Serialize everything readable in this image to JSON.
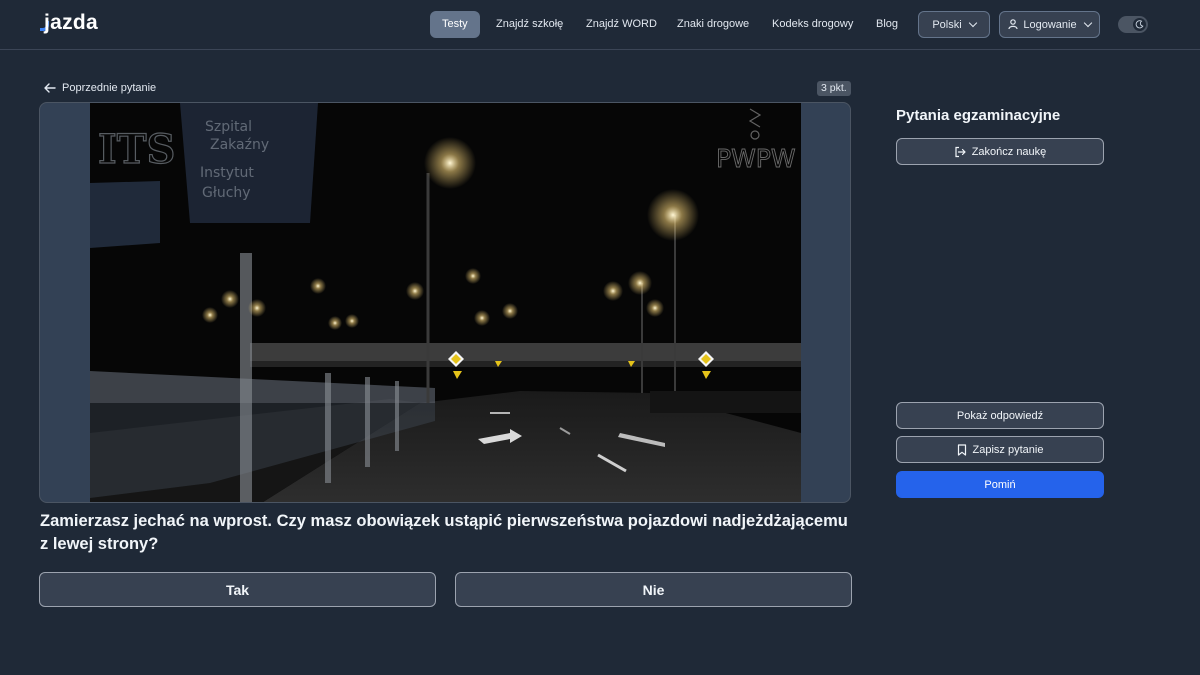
{
  "header": {
    "logo_text": "jazda",
    "nav": [
      {
        "label": "Testy",
        "active": true
      },
      {
        "label": "Znajdź szkołę"
      },
      {
        "label": "Znajdź WORD"
      },
      {
        "label": "Znaki drogowe"
      },
      {
        "label": "Kodeks drogowy"
      },
      {
        "label": "Blog"
      }
    ],
    "language_label": "Polski",
    "login_label": "Logowanie",
    "theme_toggle_icon": "moon-icon"
  },
  "question_nav": {
    "back_label": "Poprzednie pytanie",
    "points_label": "3 pkt."
  },
  "media": {
    "watermark_left": "ITS",
    "watermark_right": "PWPW",
    "sign_text_1": "Szpital",
    "sign_text_2": "Zakaźny",
    "sign_text_3": "Instytut",
    "sign_text_4": "Głuchy"
  },
  "question": {
    "text": "Zamierzasz jechać na wprost. Czy masz obowiązek ustąpić pierwszeństwa pojazdowi nadjeżdżającemu z lewej strony?",
    "answers": [
      "Tak",
      "Nie"
    ]
  },
  "panel": {
    "title": "Pytania egzaminacyjne",
    "finish_label": "Zakończ naukę",
    "show_answer_label": "Pokaż odpowiedź",
    "save_label": "Zapisz pytanie",
    "skip_label": "Pomiń"
  },
  "colors": {
    "background": "#1f2937",
    "accent": "#2563eb",
    "active_nav": "#64748b"
  }
}
